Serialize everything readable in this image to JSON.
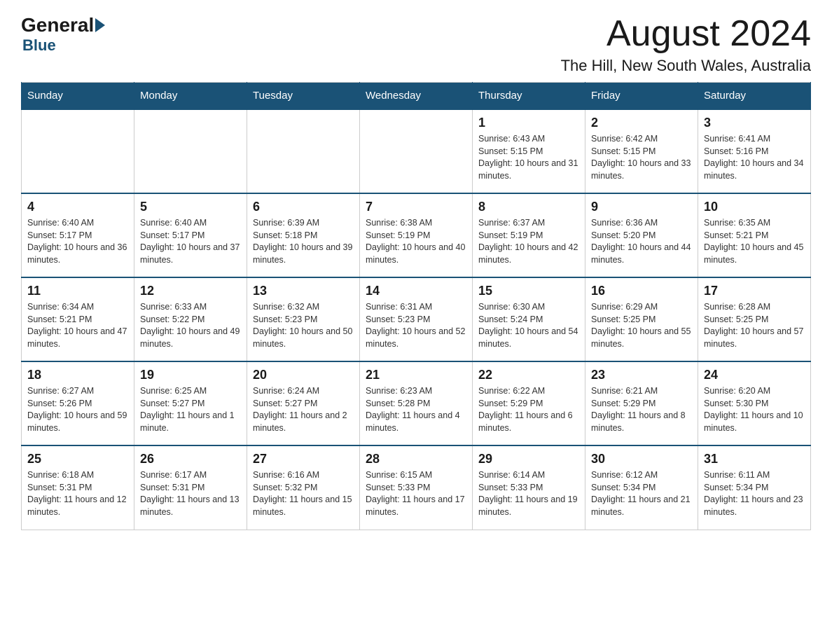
{
  "header": {
    "logo_general": "General",
    "logo_blue": "Blue",
    "month_title": "August 2024",
    "location": "The Hill, New South Wales, Australia"
  },
  "weekdays": [
    "Sunday",
    "Monday",
    "Tuesday",
    "Wednesday",
    "Thursday",
    "Friday",
    "Saturday"
  ],
  "weeks": [
    [
      {
        "day": "",
        "info": ""
      },
      {
        "day": "",
        "info": ""
      },
      {
        "day": "",
        "info": ""
      },
      {
        "day": "",
        "info": ""
      },
      {
        "day": "1",
        "info": "Sunrise: 6:43 AM\nSunset: 5:15 PM\nDaylight: 10 hours and 31 minutes."
      },
      {
        "day": "2",
        "info": "Sunrise: 6:42 AM\nSunset: 5:15 PM\nDaylight: 10 hours and 33 minutes."
      },
      {
        "day": "3",
        "info": "Sunrise: 6:41 AM\nSunset: 5:16 PM\nDaylight: 10 hours and 34 minutes."
      }
    ],
    [
      {
        "day": "4",
        "info": "Sunrise: 6:40 AM\nSunset: 5:17 PM\nDaylight: 10 hours and 36 minutes."
      },
      {
        "day": "5",
        "info": "Sunrise: 6:40 AM\nSunset: 5:17 PM\nDaylight: 10 hours and 37 minutes."
      },
      {
        "day": "6",
        "info": "Sunrise: 6:39 AM\nSunset: 5:18 PM\nDaylight: 10 hours and 39 minutes."
      },
      {
        "day": "7",
        "info": "Sunrise: 6:38 AM\nSunset: 5:19 PM\nDaylight: 10 hours and 40 minutes."
      },
      {
        "day": "8",
        "info": "Sunrise: 6:37 AM\nSunset: 5:19 PM\nDaylight: 10 hours and 42 minutes."
      },
      {
        "day": "9",
        "info": "Sunrise: 6:36 AM\nSunset: 5:20 PM\nDaylight: 10 hours and 44 minutes."
      },
      {
        "day": "10",
        "info": "Sunrise: 6:35 AM\nSunset: 5:21 PM\nDaylight: 10 hours and 45 minutes."
      }
    ],
    [
      {
        "day": "11",
        "info": "Sunrise: 6:34 AM\nSunset: 5:21 PM\nDaylight: 10 hours and 47 minutes."
      },
      {
        "day": "12",
        "info": "Sunrise: 6:33 AM\nSunset: 5:22 PM\nDaylight: 10 hours and 49 minutes."
      },
      {
        "day": "13",
        "info": "Sunrise: 6:32 AM\nSunset: 5:23 PM\nDaylight: 10 hours and 50 minutes."
      },
      {
        "day": "14",
        "info": "Sunrise: 6:31 AM\nSunset: 5:23 PM\nDaylight: 10 hours and 52 minutes."
      },
      {
        "day": "15",
        "info": "Sunrise: 6:30 AM\nSunset: 5:24 PM\nDaylight: 10 hours and 54 minutes."
      },
      {
        "day": "16",
        "info": "Sunrise: 6:29 AM\nSunset: 5:25 PM\nDaylight: 10 hours and 55 minutes."
      },
      {
        "day": "17",
        "info": "Sunrise: 6:28 AM\nSunset: 5:25 PM\nDaylight: 10 hours and 57 minutes."
      }
    ],
    [
      {
        "day": "18",
        "info": "Sunrise: 6:27 AM\nSunset: 5:26 PM\nDaylight: 10 hours and 59 minutes."
      },
      {
        "day": "19",
        "info": "Sunrise: 6:25 AM\nSunset: 5:27 PM\nDaylight: 11 hours and 1 minute."
      },
      {
        "day": "20",
        "info": "Sunrise: 6:24 AM\nSunset: 5:27 PM\nDaylight: 11 hours and 2 minutes."
      },
      {
        "day": "21",
        "info": "Sunrise: 6:23 AM\nSunset: 5:28 PM\nDaylight: 11 hours and 4 minutes."
      },
      {
        "day": "22",
        "info": "Sunrise: 6:22 AM\nSunset: 5:29 PM\nDaylight: 11 hours and 6 minutes."
      },
      {
        "day": "23",
        "info": "Sunrise: 6:21 AM\nSunset: 5:29 PM\nDaylight: 11 hours and 8 minutes."
      },
      {
        "day": "24",
        "info": "Sunrise: 6:20 AM\nSunset: 5:30 PM\nDaylight: 11 hours and 10 minutes."
      }
    ],
    [
      {
        "day": "25",
        "info": "Sunrise: 6:18 AM\nSunset: 5:31 PM\nDaylight: 11 hours and 12 minutes."
      },
      {
        "day": "26",
        "info": "Sunrise: 6:17 AM\nSunset: 5:31 PM\nDaylight: 11 hours and 13 minutes."
      },
      {
        "day": "27",
        "info": "Sunrise: 6:16 AM\nSunset: 5:32 PM\nDaylight: 11 hours and 15 minutes."
      },
      {
        "day": "28",
        "info": "Sunrise: 6:15 AM\nSunset: 5:33 PM\nDaylight: 11 hours and 17 minutes."
      },
      {
        "day": "29",
        "info": "Sunrise: 6:14 AM\nSunset: 5:33 PM\nDaylight: 11 hours and 19 minutes."
      },
      {
        "day": "30",
        "info": "Sunrise: 6:12 AM\nSunset: 5:34 PM\nDaylight: 11 hours and 21 minutes."
      },
      {
        "day": "31",
        "info": "Sunrise: 6:11 AM\nSunset: 5:34 PM\nDaylight: 11 hours and 23 minutes."
      }
    ]
  ]
}
